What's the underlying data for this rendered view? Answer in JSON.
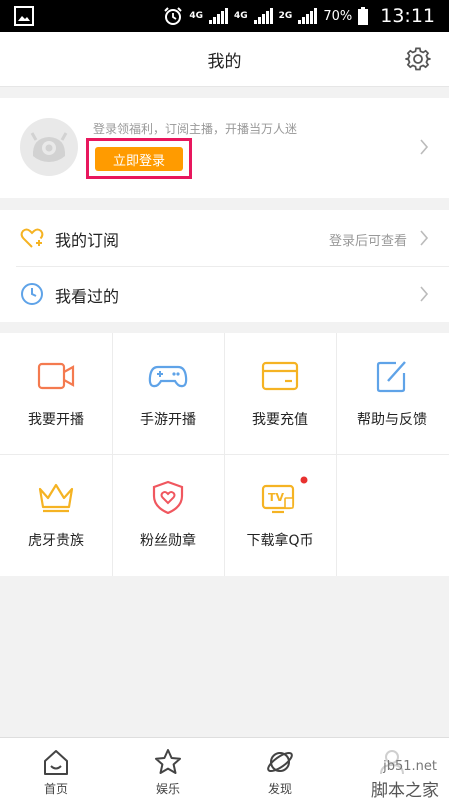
{
  "status_bar": {
    "network_1": "4G",
    "network_2": "4G",
    "network_3": "2G",
    "battery": "70%",
    "time": "13:11"
  },
  "header": {
    "title": "我的"
  },
  "profile": {
    "promo_text": "登录领福利，订阅主播，开播当万人迷",
    "login_label": "立即登录"
  },
  "list": [
    {
      "label": "我的订阅",
      "hint": "登录后可查看"
    },
    {
      "label": "我看过的",
      "hint": ""
    }
  ],
  "grid": [
    {
      "label": "我要开播",
      "icon": "video-camera-icon"
    },
    {
      "label": "手游开播",
      "icon": "gamepad-icon"
    },
    {
      "label": "我要充值",
      "icon": "wallet-icon"
    },
    {
      "label": "帮助与反馈",
      "icon": "edit-icon"
    },
    {
      "label": "虎牙贵族",
      "icon": "crown-icon"
    },
    {
      "label": "粉丝勋章",
      "icon": "heart-shield-icon"
    },
    {
      "label": "下载拿Q币",
      "icon": "tv-icon"
    }
  ],
  "tabbar": [
    {
      "label": "首页",
      "icon": "home-icon"
    },
    {
      "label": "娱乐",
      "icon": "star-icon"
    },
    {
      "label": "发现",
      "icon": "planet-icon"
    },
    {
      "label": "我的",
      "icon": "profile-icon"
    }
  ],
  "watermark": {
    "site": "jb51.net",
    "name": "脚本之家"
  },
  "colors": {
    "accent_orange": "#ff9b00",
    "highlight_pink": "#e8175d",
    "icon_orange": "#f47a4f",
    "icon_blue": "#5fa3e8",
    "icon_yellow": "#f5b323",
    "icon_red": "#f0575f"
  }
}
